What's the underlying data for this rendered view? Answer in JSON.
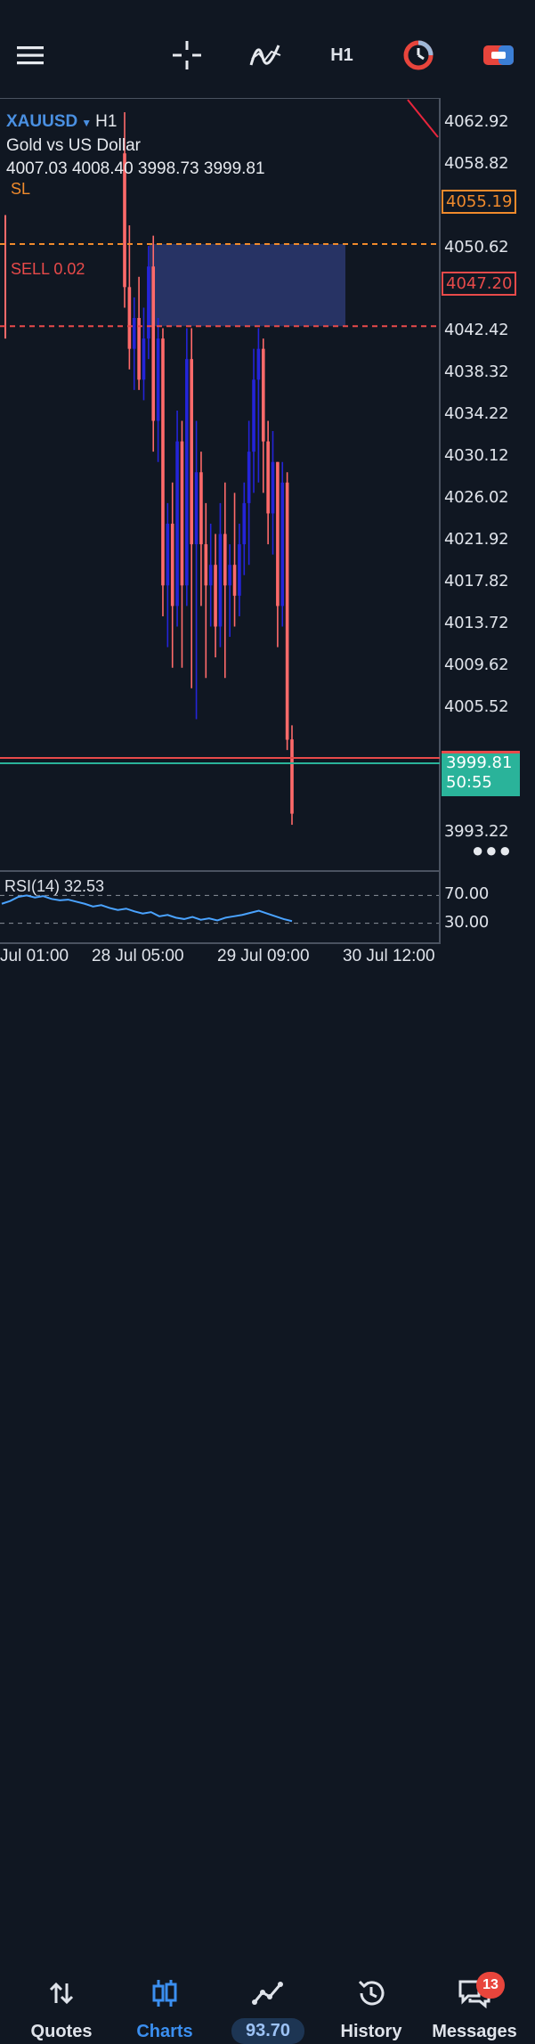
{
  "toolbar": {
    "timeframe": "H1"
  },
  "chart_info": {
    "symbol": "XAUUSD",
    "timeframe": "H1",
    "description": "Gold vs US Dollar",
    "ohlc": "4007.03 4008.40 3998.73 3999.81"
  },
  "lines": {
    "sl_label": "SL",
    "sell_label": "SELL 0.02",
    "sl_price": "4055.19",
    "sell_price": "4047.20",
    "bid_price": "3999.81",
    "countdown": "50:55"
  },
  "price_axis": [
    "4062.92",
    "4058.82",
    "4050.62",
    "4042.42",
    "4038.32",
    "4034.22",
    "4030.12",
    "4026.02",
    "4021.92",
    "4017.82",
    "4013.72",
    "4009.62",
    "4005.52",
    "3993.22"
  ],
  "rsi": {
    "label": "RSI(14) 32.53",
    "level_high": "70.00",
    "level_low": "30.00"
  },
  "time_axis": [
    "Jul 01:00",
    "28 Jul 05:00",
    "29 Jul 09:00",
    "30 Jul 12:00"
  ],
  "nav": {
    "quotes": "Quotes",
    "charts": "Charts",
    "balance": "93.70",
    "history": "History",
    "messages": "Messages",
    "messages_badge": "13"
  },
  "colors": {
    "background": "#101722",
    "bull_candle": "#2424d8",
    "bear_candle": "#ff6a6a",
    "sl_line": "#f08a2c",
    "sell_line": "#e84a4a",
    "bid_line": "#2ab39a",
    "accent": "#3b8ff0"
  },
  "chart_data": {
    "type": "candlestick",
    "symbol": "XAUUSD",
    "timeframe": "H1",
    "ylim": [
      3990,
      4066
    ],
    "x_ticks": [
      "Jul 01:00",
      "28 Jul 05:00",
      "29 Jul 09:00",
      "30 Jul 12:00"
    ],
    "candles": [
      {
        "o": 4064,
        "h": 4068,
        "l": 4049,
        "c": 4051
      },
      {
        "o": 4051,
        "h": 4057,
        "l": 4043,
        "c": 4045
      },
      {
        "o": 4045,
        "h": 4050,
        "l": 4041,
        "c": 4048
      },
      {
        "o": 4048,
        "h": 4052,
        "l": 4041,
        "c": 4042
      },
      {
        "o": 4042,
        "h": 4049,
        "l": 4040,
        "c": 4046
      },
      {
        "o": 4046,
        "h": 4055,
        "l": 4044,
        "c": 4053
      },
      {
        "o": 4053,
        "h": 4056,
        "l": 4035,
        "c": 4038
      },
      {
        "o": 4038,
        "h": 4048,
        "l": 4034,
        "c": 4046
      },
      {
        "o": 4046,
        "h": 4047,
        "l": 4019,
        "c": 4022
      },
      {
        "o": 4022,
        "h": 4030,
        "l": 4016,
        "c": 4028
      },
      {
        "o": 4028,
        "h": 4032,
        "l": 4014,
        "c": 4020
      },
      {
        "o": 4020,
        "h": 4039,
        "l": 4018,
        "c": 4036
      },
      {
        "o": 4036,
        "h": 4038,
        "l": 4014,
        "c": 4022
      },
      {
        "o": 4022,
        "h": 4047,
        "l": 4020,
        "c": 4044
      },
      {
        "o": 4044,
        "h": 4047,
        "l": 4012,
        "c": 4026
      },
      {
        "o": 4026,
        "h": 4038,
        "l": 4009,
        "c": 4033
      },
      {
        "o": 4033,
        "h": 4035,
        "l": 4020,
        "c": 4026
      },
      {
        "o": 4026,
        "h": 4030,
        "l": 4013,
        "c": 4022
      },
      {
        "o": 4022,
        "h": 4028,
        "l": 4018,
        "c": 4024
      },
      {
        "o": 4024,
        "h": 4027,
        "l": 4015,
        "c": 4018
      },
      {
        "o": 4018,
        "h": 4030,
        "l": 4016,
        "c": 4027
      },
      {
        "o": 4027,
        "h": 4032,
        "l": 4013,
        "c": 4022
      },
      {
        "o": 4022,
        "h": 4026,
        "l": 4017,
        "c": 4024
      },
      {
        "o": 4024,
        "h": 4031,
        "l": 4018,
        "c": 4021
      },
      {
        "o": 4021,
        "h": 4028,
        "l": 4019,
        "c": 4026
      },
      {
        "o": 4026,
        "h": 4032,
        "l": 4023,
        "c": 4030
      },
      {
        "o": 4030,
        "h": 4038,
        "l": 4024,
        "c": 4035
      },
      {
        "o": 4035,
        "h": 4045,
        "l": 4031,
        "c": 4042
      },
      {
        "o": 4042,
        "h": 4047,
        "l": 4032,
        "c": 4045
      },
      {
        "o": 4045,
        "h": 4046,
        "l": 4031,
        "c": 4036
      },
      {
        "o": 4036,
        "h": 4038,
        "l": 4026,
        "c": 4029
      },
      {
        "o": 4029,
        "h": 4037,
        "l": 4025,
        "c": 4034
      },
      {
        "o": 4034,
        "h": 4034,
        "l": 4016,
        "c": 4020
      },
      {
        "o": 4020,
        "h": 4034,
        "l": 4018,
        "c": 4032
      },
      {
        "o": 4032,
        "h": 4033,
        "l": 4006,
        "c": 4007
      },
      {
        "o": 4007.03,
        "h": 4008.4,
        "l": 3998.73,
        "c": 3999.81
      }
    ],
    "horizontal_lines": [
      {
        "name": "SL",
        "value": 4055.19
      },
      {
        "name": "SELL 0.02",
        "value": 4047.2
      },
      {
        "name": "bid",
        "value": 3999.81
      }
    ],
    "zone": {
      "from": 4047.2,
      "to": 4055.19
    },
    "rsi": {
      "period": 14,
      "last": 32.53,
      "levels": [
        70,
        30
      ],
      "values": [
        58,
        62,
        68,
        70,
        67,
        69,
        65,
        63,
        64,
        61,
        58,
        54,
        56,
        52,
        49,
        51,
        47,
        44,
        46,
        40,
        42,
        38,
        36,
        39,
        35,
        37,
        34,
        38,
        40,
        42,
        45,
        48,
        44,
        40,
        36,
        33
      ]
    }
  }
}
